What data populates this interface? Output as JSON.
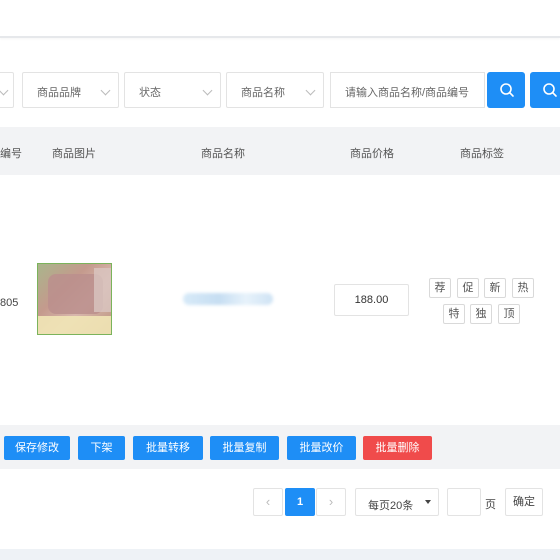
{
  "filters": {
    "brand_label": "商品品牌",
    "status_label": "状态",
    "field_label": "商品名称",
    "search_placeholder": "请输入商品名称/商品编号"
  },
  "table": {
    "headers": {
      "id": "编号",
      "image": "商品图片",
      "name": "商品名称",
      "price": "商品价格",
      "tags": "商品标签"
    },
    "rows": [
      {
        "id": "805",
        "price": "188.00",
        "tags": [
          "荐",
          "促",
          "新",
          "热",
          "特",
          "独",
          "顶"
        ]
      }
    ]
  },
  "actions": {
    "save": "保存修改",
    "offshelf": "下架",
    "batch_move": "批量转移",
    "batch_copy": "批量复制",
    "batch_price": "批量改价",
    "batch_delete": "批量删除"
  },
  "pagination": {
    "prev_label": "‹",
    "current_page": "1",
    "next_label": "›",
    "page_size": "每页20条",
    "page_unit": "页",
    "confirm": "确定"
  },
  "colors": {
    "primary": "#1e8ef6",
    "danger": "#f04b4b",
    "header_bg": "#f2f3f5"
  }
}
